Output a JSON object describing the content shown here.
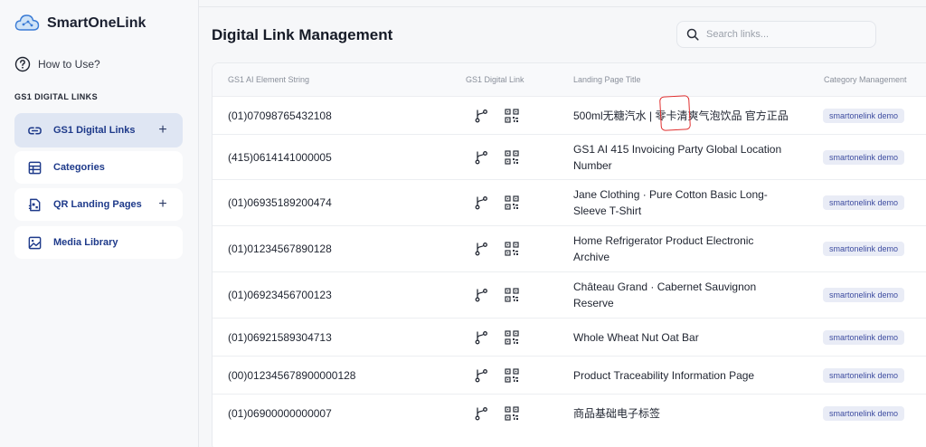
{
  "app": {
    "brand_name": "SmartOneLink",
    "how_to_label": "How to Use?",
    "section_title": "GS1 DIGITAL LINKS",
    "nav": [
      {
        "label": "GS1 Digital Links",
        "icon": "link-icon",
        "has_plus": true,
        "active": true
      },
      {
        "label": "Categories",
        "icon": "table-grid-icon",
        "has_plus": false,
        "active": false
      },
      {
        "label": "QR Landing Pages",
        "icon": "qr-page-icon",
        "has_plus": true,
        "active": false
      },
      {
        "label": "Media Library",
        "icon": "image-icon",
        "has_plus": false,
        "active": false
      }
    ]
  },
  "main": {
    "title": "Digital Link Management",
    "search_placeholder": "Search links...",
    "columns": [
      "GS1 AI Element String",
      "GS1 Digital Link",
      "Landing Page Title",
      "Category Management"
    ],
    "rows": [
      {
        "element": "(01)07098765432108",
        "title": "500ml无糖汽水 | 零卡清爽气泡饮品 官方正品",
        "category": "smartonelink demo"
      },
      {
        "element": "(415)0614141000005",
        "title": "GS1 AI 415 Invoicing Party Global Location Number",
        "category": "smartonelink demo"
      },
      {
        "element": "(01)06935189200474",
        "title": "Jane Clothing · Pure Cotton Basic Long-Sleeve T-Shirt",
        "category": "smartonelink demo"
      },
      {
        "element": "(01)01234567890128",
        "title": "Home Refrigerator Product Electronic Archive",
        "category": "smartonelink demo"
      },
      {
        "element": "(01)06923456700123",
        "title": "Château Grand · Cabernet Sauvignon Reserve",
        "category": "smartonelink demo"
      },
      {
        "element": "(01)06921589304713",
        "title": "Whole Wheat Nut Oat Bar",
        "category": "smartonelink demo"
      },
      {
        "element": "(00)012345678900000128",
        "title": "Product Traceability Information Page",
        "category": "smartonelink demo"
      },
      {
        "element": "(01)06900000000007",
        "title": "商品基础电子标签",
        "category": "smartonelink demo"
      }
    ]
  },
  "colors": {
    "accent": "#1e3a8a",
    "active_nav_bg": "#dfe6f3",
    "badge_bg": "#e9ecf6",
    "badge_text": "#3d4ca0",
    "annotation": "#e03030"
  }
}
